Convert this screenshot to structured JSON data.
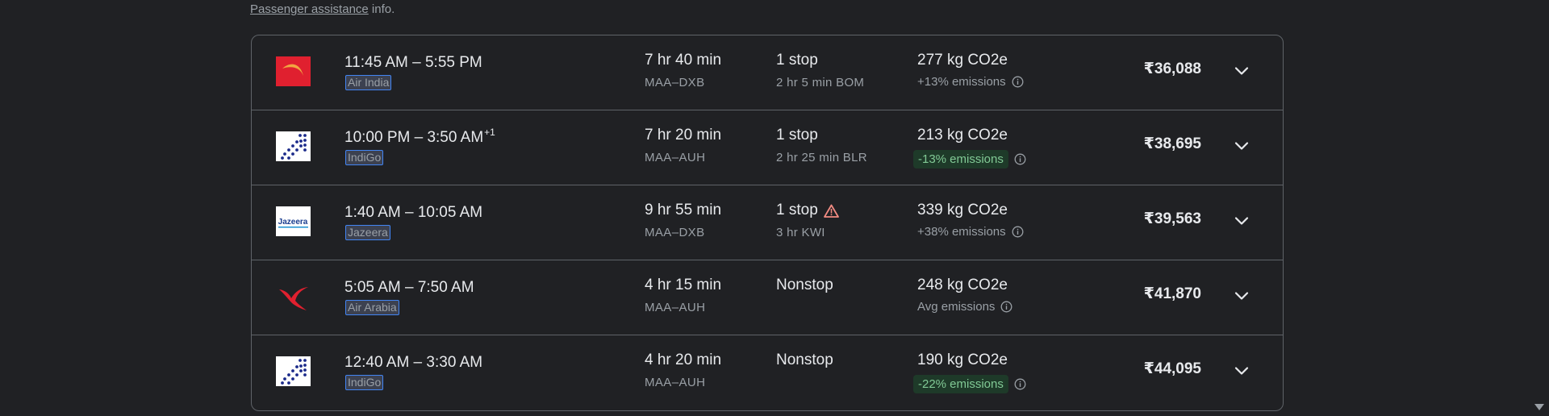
{
  "assistance": {
    "link_text": "Passenger assistance",
    "suffix": " info."
  },
  "flights": [
    {
      "times": "11:45 AM – 5:55 PM",
      "plus_day": "",
      "airline": "Air India",
      "logo": "air-india-logo",
      "duration": "7 hr 40 min",
      "route": "MAA–DXB",
      "stops": "1 stop",
      "stop_detail": "2 hr 5 min BOM",
      "warning": false,
      "co2": "277 kg CO2e",
      "emissions": "+13% emissions",
      "emissions_style": "plain",
      "price": "₹36,088"
    },
    {
      "times": "10:00 PM – 3:50 AM",
      "plus_day": "+1",
      "airline": "IndiGo",
      "logo": "indigo-logo",
      "duration": "7 hr 20 min",
      "route": "MAA–AUH",
      "stops": "1 stop",
      "stop_detail": "2 hr 25 min BLR",
      "warning": false,
      "co2": "213 kg CO2e",
      "emissions": "-13% emissions",
      "emissions_style": "pill",
      "price": "₹38,695"
    },
    {
      "times": "1:40 AM – 10:05 AM",
      "plus_day": "",
      "airline": "Jazeera",
      "logo": "jazeera-logo",
      "duration": "9 hr 55 min",
      "route": "MAA–DXB",
      "stops": "1 stop",
      "stop_detail": "3 hr KWI",
      "warning": true,
      "co2": "339 kg CO2e",
      "emissions": "+38% emissions",
      "emissions_style": "plain",
      "price": "₹39,563"
    },
    {
      "times": "5:05 AM – 7:50 AM",
      "plus_day": "",
      "airline": "Air Arabia",
      "logo": "air-arabia-logo",
      "duration": "4 hr 15 min",
      "route": "MAA–AUH",
      "stops": "Nonstop",
      "stop_detail": "",
      "warning": false,
      "co2": "248 kg CO2e",
      "emissions": "Avg emissions",
      "emissions_style": "plain",
      "price": "₹41,870"
    },
    {
      "times": "12:40 AM – 3:30 AM",
      "plus_day": "",
      "airline": "IndiGo",
      "logo": "indigo-logo",
      "duration": "4 hr 20 min",
      "route": "MAA–AUH",
      "stops": "Nonstop",
      "stop_detail": "",
      "warning": false,
      "co2": "190 kg CO2e",
      "emissions": "-22% emissions",
      "emissions_style": "pill",
      "price": "₹44,095"
    }
  ],
  "colors": {
    "background": "#202124",
    "border": "#5f6368",
    "text_primary": "#e8eaed",
    "text_secondary": "#9aa0a6",
    "green_pill_bg": "#1e3a29",
    "green_pill_text": "#81c995",
    "warning": "#f28b82"
  }
}
